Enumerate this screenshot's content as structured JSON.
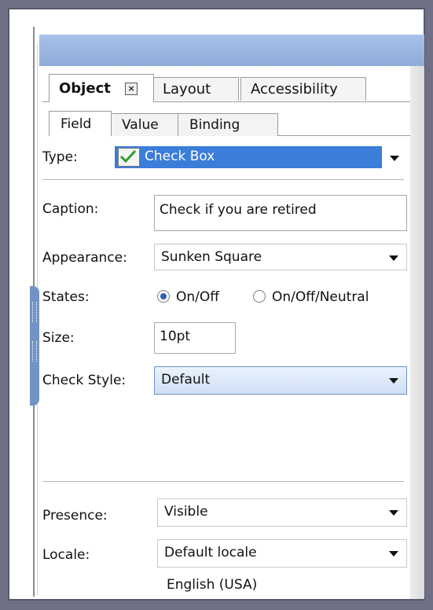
{
  "tabs": [
    {
      "label": "Object"
    },
    {
      "label": "Layout"
    },
    {
      "label": "Accessibility"
    }
  ],
  "subtabs": [
    {
      "label": "Field"
    },
    {
      "label": "Value"
    },
    {
      "label": "Binding"
    }
  ],
  "fields": {
    "type": {
      "label": "Type:",
      "value": "Check Box"
    },
    "caption": {
      "label": "Caption:",
      "value": "Check if you are retired"
    },
    "appearance": {
      "label": "Appearance:",
      "value": "Sunken Square"
    },
    "states": {
      "label": "States:",
      "options": [
        "On/Off",
        "On/Off/Neutral"
      ],
      "selected": "On/Off"
    },
    "size": {
      "label": "Size:",
      "value": "10pt"
    },
    "check_style": {
      "label": "Check Style:",
      "value": "Default"
    },
    "presence": {
      "label": "Presence:",
      "value": "Visible"
    },
    "locale": {
      "label": "Locale:",
      "value": "Default locale",
      "detail": "English (USA)"
    }
  },
  "colors": {
    "accent": "#3b7dd8",
    "header": "#8eabd9"
  }
}
